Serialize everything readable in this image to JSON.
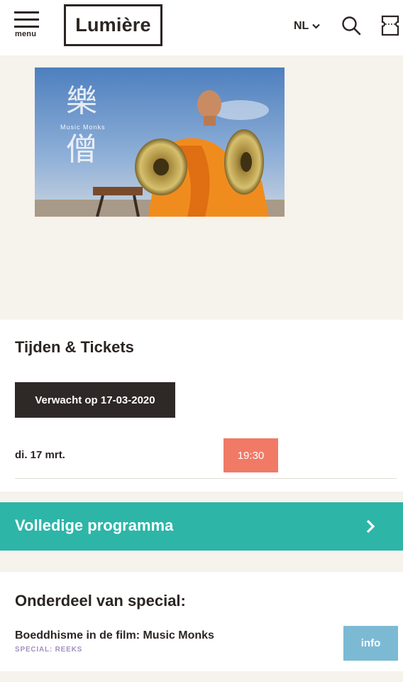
{
  "header": {
    "menu_label": "menu",
    "logo_text": "Lumière",
    "language": "NL"
  },
  "hero": {
    "image_text": "Music Monks"
  },
  "tickets": {
    "title": "Tijden & Tickets",
    "expected_label": "Verwacht op 17-03-2020",
    "date": "di. 17 mrt.",
    "time": "19:30"
  },
  "programme": {
    "label": "Volledige programma"
  },
  "special": {
    "title": "Onderdeel van special:",
    "name": "Boeddhisme in de film: Music Monks",
    "type": "SPECIAL: REEKS",
    "info_label": "info"
  },
  "colors": {
    "page_background": "#f6f2ec",
    "dark": "#2b2523",
    "time_button": "#f07a66",
    "programme_bar": "#2db5a8",
    "info_button": "#7cbad4",
    "special_type": "#a58fbf"
  },
  "icons": [
    "hamburger-icon",
    "chevron-down-icon",
    "search-icon",
    "ticket-icon",
    "chevron-right-icon"
  ]
}
